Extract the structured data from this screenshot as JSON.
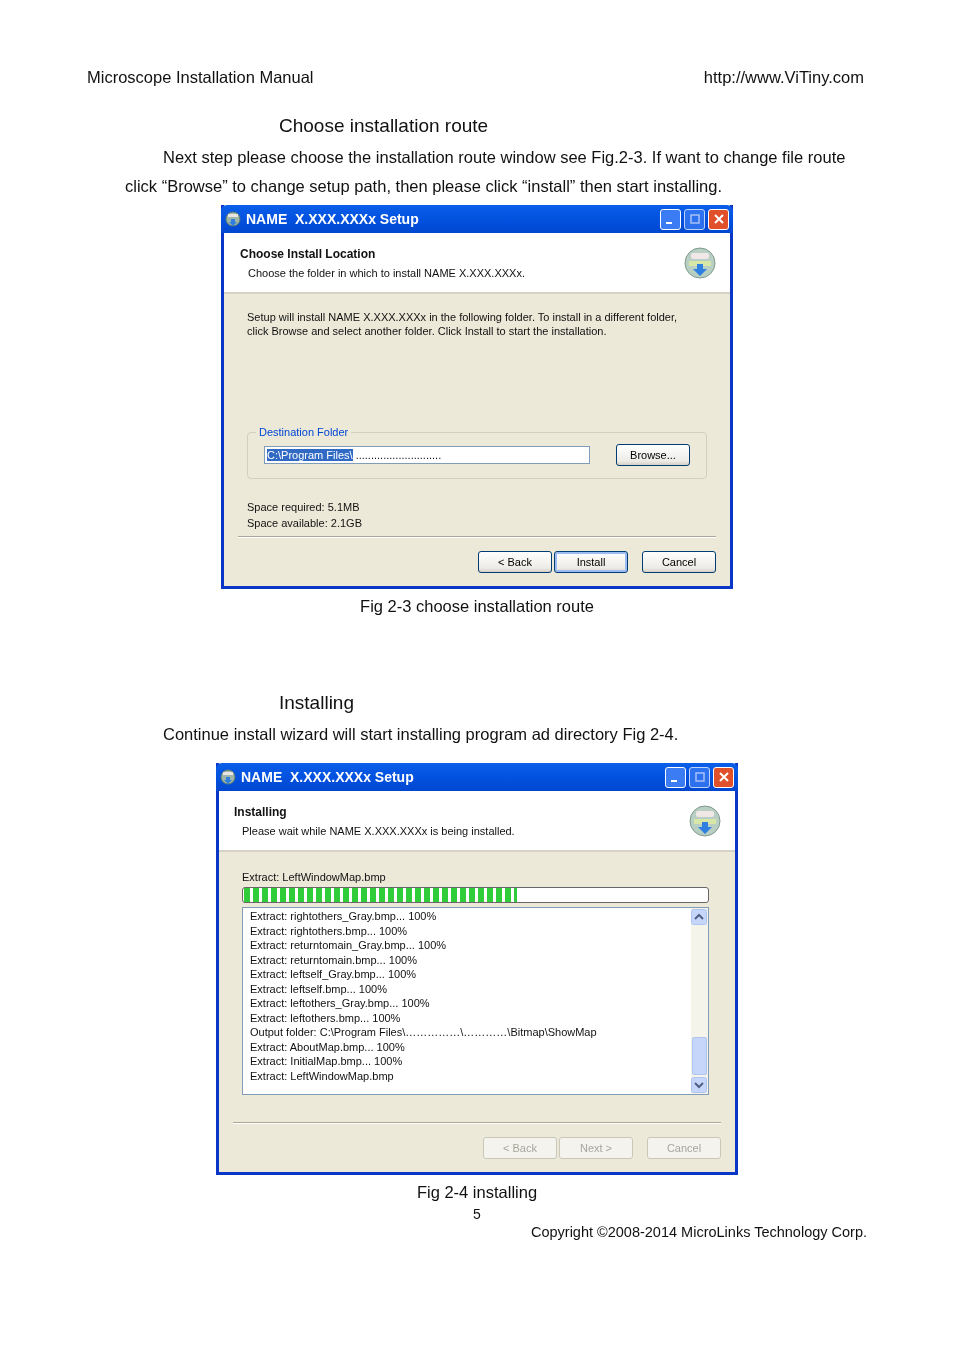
{
  "header": {
    "left": "Microscope Installation Manual",
    "right": "http://www.ViTiny.com"
  },
  "sections": [
    {
      "heading": "Choose installation route",
      "paragraph": "Next step please choose the installation route window see Fig.2-3. If want to change file route click “Browse” to change setup path, then please click “install” then start installing.",
      "window": {
        "kind": "location",
        "title": "NAME  X.XXX.XXXx Setup",
        "page_title": "Choose Install Location",
        "page_subtitle": "Choose the folder in which to install NAME X.XXX.XXXx.",
        "description": "Setup will install  NAME X.XXX.XXXx  in the following folder. To install in a different folder, click Browse and select another folder. Click Install to start the installation.",
        "group_label": "Destination Folder",
        "field": [
          {
            "text": "C:\\Program Files\\",
            "selected": true
          },
          {
            "text": " ............................",
            "selected": false
          }
        ],
        "browse": "Browse...",
        "space": [
          "Space required: 5.1MB",
          "Space available: 2.1GB"
        ],
        "buttons": [
          {
            "label": "< Back",
            "disabled": false,
            "default": false
          },
          {
            "label": "Install",
            "disabled": false,
            "default": true
          },
          {
            "label": "Cancel",
            "disabled": false,
            "default": false
          }
        ]
      },
      "caption": "Fig 2-3 choose installation route"
    },
    {
      "heading": "Installing",
      "paragraph": "Continue install wizard will start installing program ad directory Fig 2-4.",
      "window": {
        "kind": "progress",
        "title": "NAME  X.XXX.XXXx Setup",
        "page_title": "Installing",
        "page_subtitle": "Please wait while NAME X.XXX.XXXx is being installed.",
        "status": "Extract: LeftWindowMap.bmp",
        "level": 0.59,
        "log": [
          "Extract: rightothers_Gray.bmp... 100%",
          "Extract: rightothers.bmp... 100%",
          "Extract: returntomain_Gray.bmp... 100%",
          "Extract: returntomain.bmp... 100%",
          "Extract: leftself_Gray.bmp... 100%",
          "Extract: leftself.bmp... 100%",
          "Extract: leftothers_Gray.bmp... 100%",
          "Extract: leftothers.bmp... 100%",
          "Output folder: C:\\Program Files\\……………\\…………\\Bitmap\\ShowMap",
          "Extract: AboutMap.bmp... 100%",
          "Extract: InitialMap.bmp... 100%",
          "Extract: LeftWindowMap.bmp"
        ],
        "buttons": [
          {
            "label": "< Back",
            "disabled": true,
            "default": false
          },
          {
            "label": "Next >",
            "disabled": true,
            "default": false
          },
          {
            "label": "Cancel",
            "disabled": true,
            "default": false
          }
        ]
      },
      "caption": "Fig 2-4 installing"
    }
  ],
  "page_number": "5",
  "copyright": "Copyright ©2008-2014 MicroLinks Technology Corp."
}
